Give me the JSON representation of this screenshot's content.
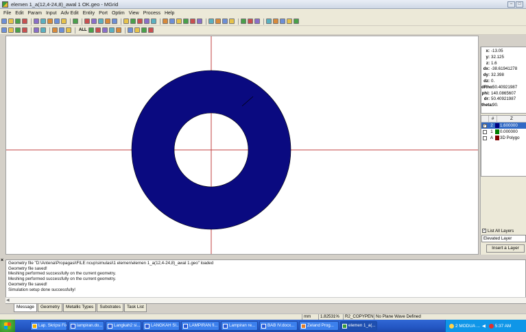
{
  "window": {
    "title": "elemen 1_a(12,4-24,8)_awal 1 OK.geo - MGrid",
    "controls": [
      "minimize-icon",
      "maximize-icon"
    ]
  },
  "menu": [
    "File",
    "Edit",
    "Param",
    "Input",
    "Adv Edit",
    "Entity",
    "Port",
    "Optim",
    "View",
    "Process",
    "Help"
  ],
  "toolbar_icons": {
    "row1": [
      "new-icon",
      "open-icon",
      "save-icon",
      "print-icon",
      "help-icon",
      "whats-this-icon",
      "layers-icon",
      "grid-icon",
      "ruler-icon",
      "esc-icon",
      "pencil-icon",
      "edit-vertex-icon",
      "edit-icon",
      "edit-icon",
      "eye-icon",
      "cut-icon",
      "copy-icon",
      "paste-icon",
      "delete-icon",
      "chart-icon",
      "move-icon",
      "rotate-icon",
      "mirror-icon",
      "align-icon",
      "array-icon",
      "flatten-icon",
      "mesh-icon",
      "dimension-icon",
      "dimension-icon",
      "connect-icon",
      "undo-icon",
      "redo-icon",
      "measure-icon",
      "tools-icon",
      "arrow-icon",
      "fill-icon",
      "polygon-icon",
      "snap-icon"
    ],
    "row2": [
      "snap-grid-icon",
      "snap-point-icon",
      "snap-edge-icon",
      "snap-box-icon",
      "pan-icon",
      "grid-toggle-icon",
      "axes-icon",
      "circle-icon",
      "rectangle-icon",
      "zoom-all-icon",
      "zoom-box-icon",
      "zoom-in-icon",
      "zoom-out-icon",
      "zoom-fit-icon",
      "arrow-left-icon",
      "arrow-right-icon",
      "arrow-down-icon",
      "arrow-up-icon"
    ],
    "row2_labels": [
      "ALL"
    ]
  },
  "coordinates": [
    {
      "label": "x:",
      "value": "-13.05"
    },
    {
      "label": "y:",
      "value": "32.125"
    },
    {
      "label": "z:",
      "value": "1.6"
    },
    {
      "label": "dx:",
      "value": "-38.61941278"
    },
    {
      "label": "dy:",
      "value": "32.398"
    },
    {
      "label": "dz:",
      "value": "0."
    },
    {
      "label": "dRho:",
      "value": "50.40921987"
    },
    {
      "label": "phi:",
      "value": "140.0865607"
    },
    {
      "label": "dr:",
      "value": "50.40921987"
    },
    {
      "label": "theta:",
      "value": "90."
    }
  ],
  "layers": {
    "headers": [
      "",
      "#",
      "Z"
    ],
    "rows": [
      {
        "checked": true,
        "id": "2",
        "color": "#000080",
        "name": "1.600000",
        "selected": true
      },
      {
        "checked": false,
        "id": "1",
        "color": "#008000",
        "name": "0.000000",
        "selected": false
      },
      {
        "checked": false,
        "id": "A",
        "color": "#800000",
        "name": "3D Polygo",
        "selected": false
      }
    ],
    "list_all_label": "List All Layers",
    "list_all_checked": true,
    "elevated_label": "Elevated Layer",
    "insert_button": "Insert a Layer"
  },
  "messages": [
    "Geometry file \"D:\\Antena\\Propagasi\\FILE ncup\\simulasi\\1 elemen\\elemen 1_a(12,4-24,8)_awal 1.geo\" loaded",
    "Geometry file saved!",
    "Meshing performed successfully on the current geometry.",
    "Meshing performed successfully on the current geometry.",
    "Geometry file saved!",
    "Simulation setup done successfully!"
  ],
  "message_tabs": [
    "Message",
    "Geometry",
    "Metallic Types",
    "Substrates",
    "Task List"
  ],
  "status": {
    "unit": "mm",
    "zoom": "1.82531%",
    "mode": "R2_COPYPEN",
    "wave": "No Plane Wave Defined"
  },
  "taskbar": {
    "tasks": [
      {
        "label": "Lap. Skripsi Fix",
        "color": "#f0b000"
      },
      {
        "label": "lampiran.do...",
        "color": "#2a5bd7"
      },
      {
        "label": "Langkah2 si...",
        "color": "#2a5bd7"
      },
      {
        "label": "LANGKAH SI...",
        "color": "#2a5bd7"
      },
      {
        "label": "LAMPIRAN fi...",
        "color": "#2a5bd7"
      },
      {
        "label": "Lampiran re...",
        "color": "#2a5bd7"
      },
      {
        "label": "BAB IV.docx...",
        "color": "#2a5bd7"
      },
      {
        "label": "Zeland Prog...",
        "color": "#e08030"
      },
      {
        "label": "elemen 1_a(...",
        "color": "#3a9b3a"
      }
    ],
    "tray_label": "2 MODUA ...",
    "clock": "5:37 AM"
  },
  "colors": {
    "ring": "#0a0a80",
    "crosshair": "#c04040",
    "selection": "#316ac5"
  }
}
